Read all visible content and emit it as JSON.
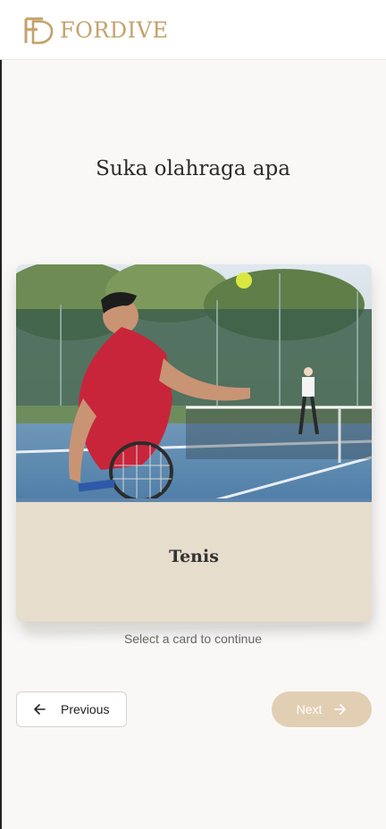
{
  "brand": {
    "name": "FORDIVE",
    "logo_icon": "fd-monogram-icon"
  },
  "question": {
    "title": "Suka olahraga apa"
  },
  "card": {
    "label": "Tenis",
    "image": "tennis-player-photo"
  },
  "hint": "Select a card to continue",
  "nav": {
    "previous_label": "Previous",
    "previous_icon": "arrow-left-icon",
    "next_label": "Next",
    "next_icon": "arrow-right-icon"
  },
  "colors": {
    "brand_gold": "#c4a26b",
    "card_footer": "#e6ddcc",
    "next_button": "#e2cfb3",
    "background": "#f9f8f6"
  }
}
